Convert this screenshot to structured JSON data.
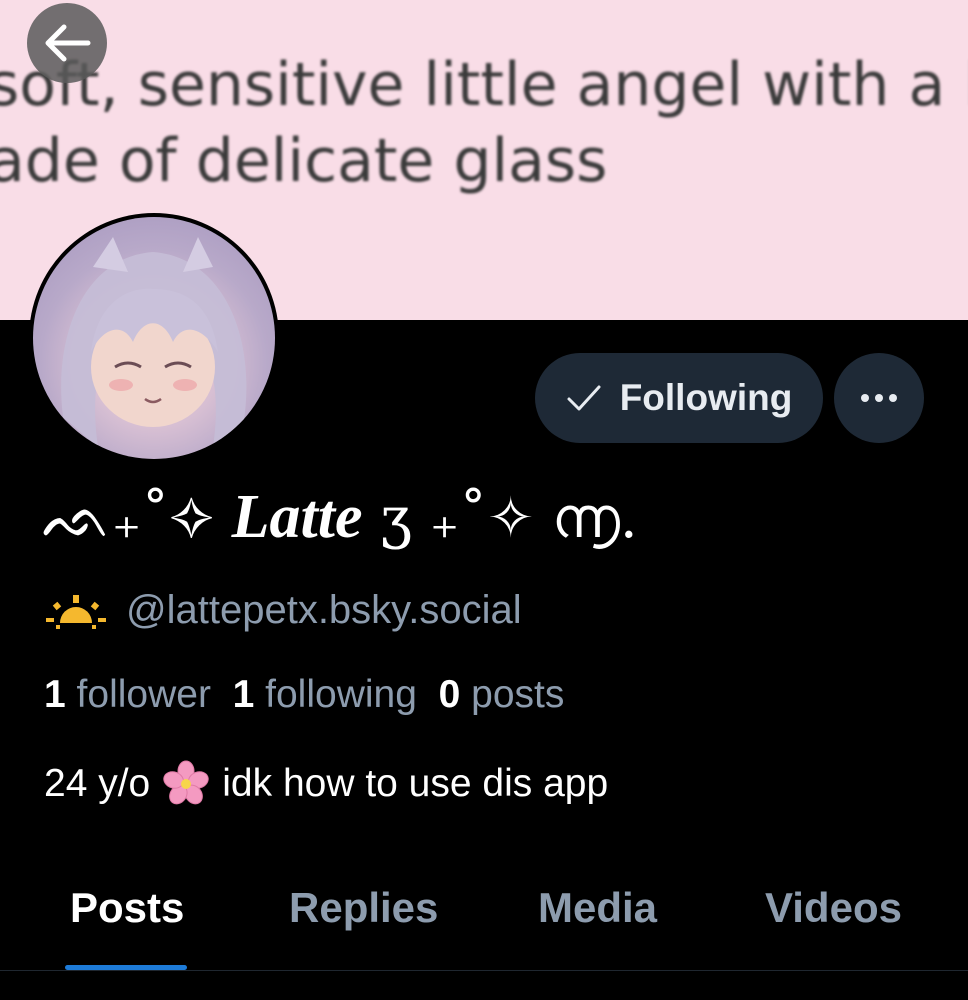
{
  "banner": {
    "line1": "soft, sensitive little angel with a he",
    "line2": "ade of delicate glass"
  },
  "back_button": {
    "icon": "arrow-left-icon"
  },
  "profile": {
    "display_name_prefix": "ᨒ₊˚✧",
    "display_name_main": "Latte",
    "display_name_suffix": "ʒ ₊˚✧ ൬.",
    "handle_icon": "sunrise-icon",
    "handle": "@lattepetx.bsky.social",
    "followers_count": "1",
    "followers_label": "follower",
    "following_count": "1",
    "following_label": "following",
    "posts_count": "0",
    "posts_label": "posts",
    "bio_prefix": "24 y/o",
    "bio_emoji": "cherry-blossom-icon",
    "bio_suffix": "idk how to use dis app"
  },
  "actions": {
    "follow_label": "Following",
    "follow_icon": "checkmark-icon",
    "more_icon": "ellipsis-icon"
  },
  "tabs": [
    {
      "label": "Posts",
      "active": true
    },
    {
      "label": "Replies",
      "active": false
    },
    {
      "label": "Media",
      "active": false
    },
    {
      "label": "Videos",
      "active": false
    }
  ],
  "colors": {
    "background": "#000000",
    "banner": "#f9dde7",
    "button_bg": "#1e2936",
    "muted_text": "#8d9cae",
    "tab_indicator": "#1d7bd8"
  }
}
